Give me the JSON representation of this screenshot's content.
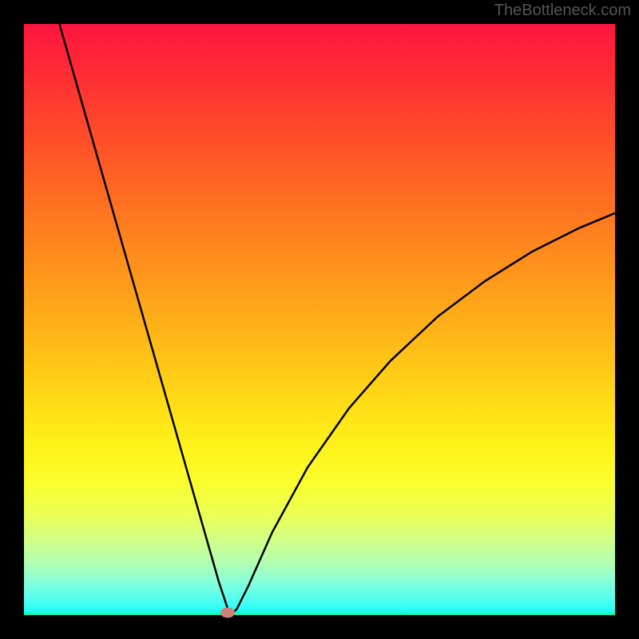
{
  "watermark": "TheBottleneck.com",
  "chart_data": {
    "type": "line",
    "title": "",
    "xlabel": "",
    "ylabel": "",
    "xlim": [
      0,
      100
    ],
    "ylim": [
      0,
      100
    ],
    "curve": [
      {
        "x": 6,
        "y": 100
      },
      {
        "x": 10,
        "y": 86
      },
      {
        "x": 14,
        "y": 72
      },
      {
        "x": 18,
        "y": 58
      },
      {
        "x": 22,
        "y": 44
      },
      {
        "x": 26,
        "y": 30
      },
      {
        "x": 30,
        "y": 16
      },
      {
        "x": 33,
        "y": 5.5
      },
      {
        "x": 34.5,
        "y": 1
      },
      {
        "x": 35.2,
        "y": 0.3
      },
      {
        "x": 36,
        "y": 1
      },
      {
        "x": 38,
        "y": 5
      },
      {
        "x": 42,
        "y": 14
      },
      {
        "x": 48,
        "y": 25
      },
      {
        "x": 55,
        "y": 35
      },
      {
        "x": 62,
        "y": 43
      },
      {
        "x": 70,
        "y": 50.5
      },
      {
        "x": 78,
        "y": 56.5
      },
      {
        "x": 86,
        "y": 61.5
      },
      {
        "x": 94,
        "y": 65.5
      },
      {
        "x": 100,
        "y": 68
      }
    ],
    "marker": {
      "x": 34.5,
      "y": 0.4
    }
  }
}
